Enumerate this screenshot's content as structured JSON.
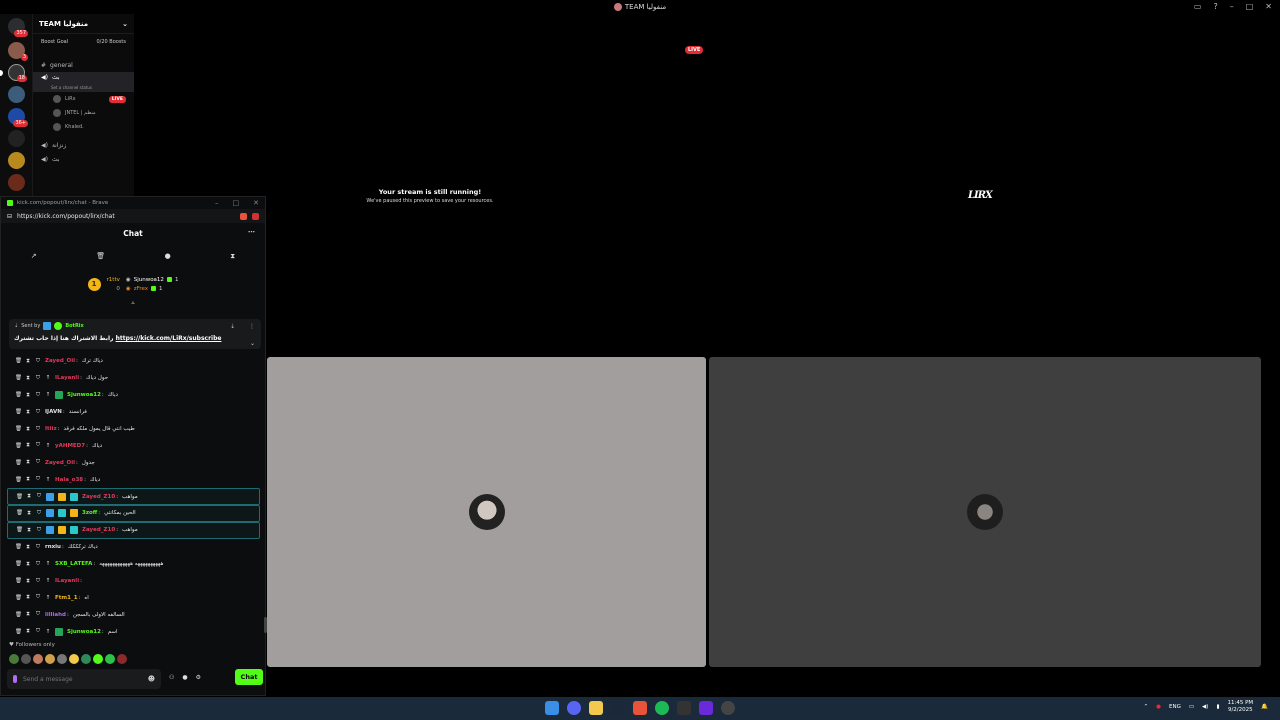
{
  "window": {
    "title": "TEAM منفوليا",
    "live_label": "LIVE"
  },
  "colors": {
    "kick_green": "#53fc18",
    "live_red": "#e12d33",
    "tile_left_bg": "#a29e9d",
    "tile_right_bg": "#3f3f3f"
  },
  "rail": {
    "badges": [
      "357",
      "3",
      "18",
      "36+"
    ]
  },
  "server": {
    "name": "TEAM منفوليا",
    "boost_goal_label": "Boost Goal",
    "boost_progress": "0/20 Boosts",
    "channels": [
      {
        "name": "general"
      },
      {
        "name": "بث",
        "status": "Set a channel status"
      }
    ],
    "voice_users": [
      {
        "name": "LiRx",
        "live": "LIVE"
      },
      {
        "name": "JNTEL | منظم"
      },
      {
        "name": "Khaled."
      }
    ],
    "extra_voice_channels": [
      "زنزانة",
      "بث"
    ]
  },
  "stream": {
    "paused_title": "Your stream is still running!",
    "paused_sub": "We've paused this preview to save your resources.",
    "streamer_logo": "LIRX"
  },
  "popout": {
    "title": "kick.com/popout/lirx/chat - Brave",
    "url": "https://kick.com/popout/lirx/chat",
    "chat_title": "Chat",
    "leaderboard": {
      "rank": "1",
      "left": [
        {
          "name": "r1ttv",
          "count": "0"
        }
      ],
      "right": [
        {
          "name": "Sjunwoa12",
          "count": "1"
        },
        {
          "name": "zFrex",
          "count": "1"
        }
      ]
    },
    "pinned": {
      "sent_by": "Sent by",
      "bot": "BotRix",
      "text": "رابط الاشتراك هنا إذا حاب تشترك",
      "link": "https://kick.com/LiRx/subscribe"
    },
    "messages": [
      {
        "user": "Zayed_Oil",
        "color": "#e3395d",
        "text": "دياك ترك",
        "arrow": false,
        "badges": []
      },
      {
        "user": "ILayanli",
        "color": "#e3395d",
        "text": "حول دياك",
        "arrow": true,
        "badges": []
      },
      {
        "user": "Sjunwoa12",
        "color": "#53fc18",
        "text": "دياك",
        "arrow": true,
        "badges": [
          "#23a55a"
        ]
      },
      {
        "user": "IJAVN",
        "color": "#e6e6e6",
        "text": "فرانسند",
        "arrow": false,
        "badges": []
      },
      {
        "user": "Itiiz",
        "color": "#e3395d",
        "text": "طيب انتي قال يمول ملكه فرقد",
        "arrow": false,
        "badges": []
      },
      {
        "user": "yAHMED7",
        "color": "#e3395d",
        "text": "دياك",
        "arrow": true,
        "badges": []
      },
      {
        "user": "Zayed_Oil",
        "color": "#e3395d",
        "text": "جدول",
        "arrow": false,
        "badges": []
      },
      {
        "user": "Hala_o38",
        "color": "#e3395d",
        "text": "دياك",
        "arrow": true,
        "badges": []
      },
      {
        "user": "Zayed_Z10",
        "color": "#e3395d",
        "text": "مواهب",
        "arrow": false,
        "badges": [
          "#3aa0e8",
          "#f2b618",
          "#2ac8c8"
        ],
        "highlight": true
      },
      {
        "user": "3zoff",
        "color": "#53fc18",
        "text": "الحين بمكانتي",
        "arrow": false,
        "badges": [
          "#3aa0e8",
          "#2ac8c8",
          "#f2b618"
        ],
        "highlight": true
      },
      {
        "user": "Zayed_Z10",
        "color": "#e3395d",
        "text": "مواهب",
        "arrow": false,
        "badges": [
          "#3aa0e8",
          "#f2b618",
          "#2ac8c8"
        ],
        "highlight": true
      },
      {
        "user": "rnxiu",
        "color": "#e6e6e6",
        "text": "دياك تركككك",
        "arrow": false,
        "badges": []
      },
      {
        "user": "SXB_LATEFA",
        "color": "#53fc18",
        "text": "ههههههههههه ههههههههههههه",
        "arrow": true,
        "badges": []
      },
      {
        "user": "ILayanli",
        "color": "#e3395d",
        "text": "",
        "arrow": true,
        "badges": []
      },
      {
        "user": "Ftm1_1",
        "color": "#f2b618",
        "text": "اه",
        "arrow": true,
        "badges": []
      },
      {
        "user": "lilliahd",
        "color": "#b36cf0",
        "text": "السالفه الاولى بالسجن",
        "arrow": false,
        "badges": []
      },
      {
        "user": "Sjunwoa12",
        "color": "#53fc18",
        "text": "اسم",
        "arrow": true,
        "badges": [
          "#23a55a"
        ]
      }
    ],
    "followers_only": "Followers only",
    "input_placeholder": "Send a message",
    "chat_button": "Chat"
  },
  "taskbar": {
    "lang": "ENG",
    "time": "11:45 PM",
    "date": "9/2/2025"
  }
}
